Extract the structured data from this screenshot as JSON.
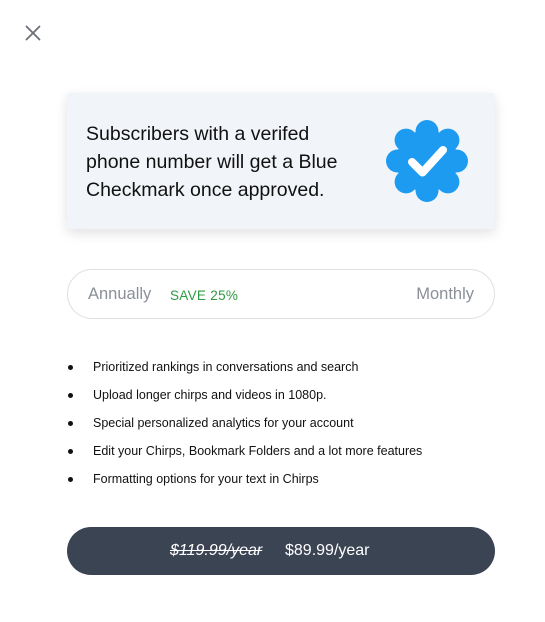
{
  "header": {
    "close_icon": "close-icon"
  },
  "verify_card": {
    "text": "Subscribers with a verifed phone number will get a Blue Checkmark once approved.",
    "badge_icon": "verified-badge-icon",
    "badge_color": "#1d9bf0",
    "background": "#f1f4f8"
  },
  "billing": {
    "annually_label": "Annually",
    "save_label": "SAVE 25%",
    "monthly_label": "Monthly",
    "save_color": "#2e9a42"
  },
  "features": [
    "Prioritized rankings in conversations and search",
    "Upload longer chirps and videos in 1080p.",
    "Special personalized analytics for your account",
    "Edit your Chirps, Bookmark Folders and a lot more features",
    "Formatting options for your text in Chirps"
  ],
  "price_button": {
    "old_price": "$119.99/year",
    "new_price": "$89.99/year",
    "background": "#3b4453"
  }
}
